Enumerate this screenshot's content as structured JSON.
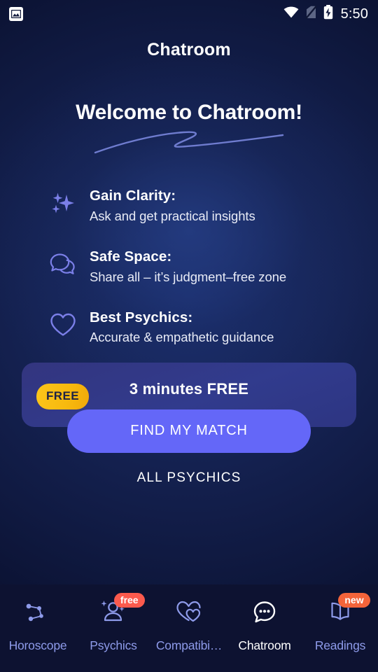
{
  "status_bar": {
    "notification_icon": "photo-icon",
    "wifi_icon": "wifi-icon",
    "signal_icon": "no-sim-icon",
    "battery_icon": "battery-charging-icon",
    "time": "5:50"
  },
  "header": {
    "title": "Chatroom"
  },
  "hero": {
    "title": "Welcome to Chatroom!",
    "underline_icon": "squiggle-underline"
  },
  "benefits": [
    {
      "icon": "sparkles-icon",
      "title": "Gain Clarity:",
      "subtitle": "Ask and get practical insights"
    },
    {
      "icon": "chat-bubbles-icon",
      "title": "Safe Space:",
      "subtitle": "Share all – it’s judgment–free zone"
    },
    {
      "icon": "heart-icon",
      "title": "Best Psychics:",
      "subtitle": "Accurate & empathetic guidance"
    }
  ],
  "promo": {
    "badge": "FREE",
    "title": "3 minutes FREE",
    "cta_label": "FIND MY MATCH",
    "card_color": "#313b8d",
    "badge_color": "#fbc51b",
    "cta_color": "#6467f8"
  },
  "secondary_link": {
    "label": "ALL PSYCHICS"
  },
  "bottom_nav": {
    "active": "Chatroom",
    "items": [
      {
        "label": "Horoscope",
        "icon": "constellation-icon",
        "badge": null
      },
      {
        "label": "Psychics",
        "icon": "person-sparkle-icon",
        "badge": "free"
      },
      {
        "label": "Compatibi…",
        "icon": "double-heart-icon",
        "badge": null
      },
      {
        "label": "Chatroom",
        "icon": "chat-dots-icon",
        "badge": null
      },
      {
        "label": "Readings",
        "icon": "open-book-icon",
        "badge": "new"
      }
    ],
    "badge_free_color": "#fb5a4d",
    "badge_new_color": "#f4643a",
    "inactive_color": "#8e9bea",
    "active_color": "#ffffff"
  }
}
